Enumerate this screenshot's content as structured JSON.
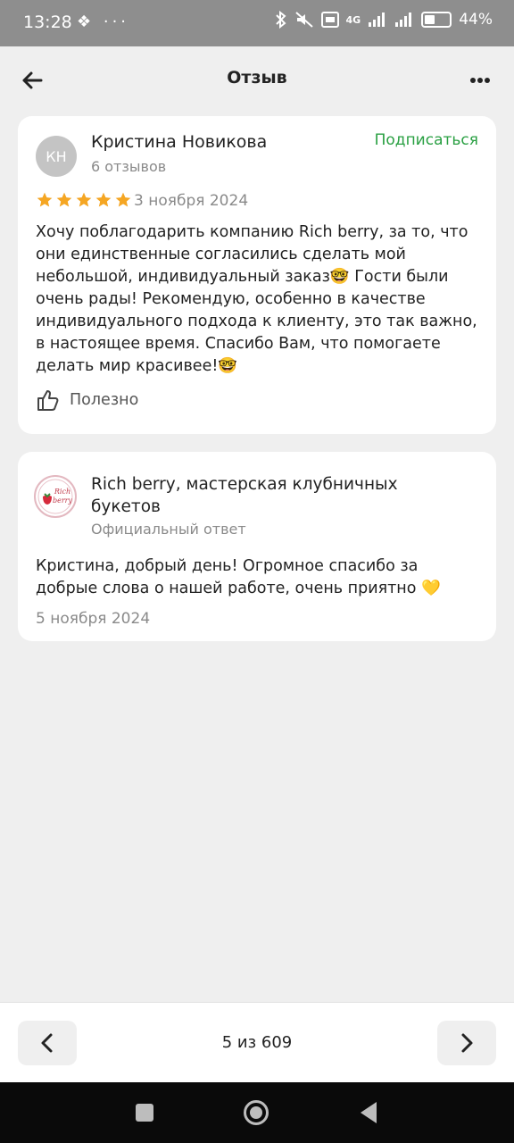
{
  "status_bar": {
    "time": "13:28",
    "left_icons": "❖ ···",
    "network": "4G",
    "battery_percent": "44%",
    "battery_level": 0.44
  },
  "header": {
    "title": "Отзыв",
    "back_icon": "arrow-left-icon",
    "more_icon": "more-dots-icon"
  },
  "review": {
    "avatar_initials": "КН",
    "author": "Кристина Новикова",
    "reviews_count": "6 отзывов",
    "subscribe_label": "Подписаться",
    "rating": 5,
    "date": "3 ноября 2024",
    "text": "Хочу поблагодарить компанию Rich berry, за то, что они единственные согласились сделать мой небольшой, индивидуальный заказ🤓 Гости были очень рады! Рекомендую, особенно в качестве индивидуального подхода к клиенту, это так важно, в настоящее время. Спасибо Вам, что помогаете делать мир красивее!🤓",
    "useful_label": "Полезно"
  },
  "reply": {
    "company": "Rich berry, мастерская клубничных букетов",
    "logo_text": "Rich berry",
    "official_label": "Официальный ответ",
    "text": "Кристина, добрый день! Огромное спасибо за добрые слова о нашей работе, очень приятно 💛",
    "date": "5 ноября 2024"
  },
  "pagination": {
    "counter": "5 из 609"
  },
  "colors": {
    "accent_green": "#2aa043",
    "star": "#f5a623",
    "background": "#efefef"
  }
}
